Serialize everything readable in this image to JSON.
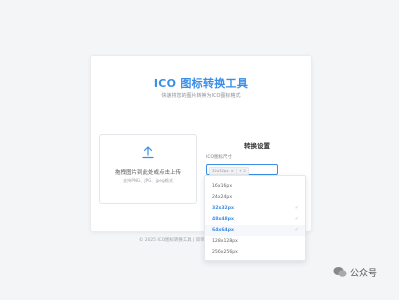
{
  "app": {
    "title": "ICO 图标转换工具",
    "subtitle": "快速将您的图片转换为ICO图标格式"
  },
  "upload": {
    "main_text": "拖拽图片到此处或点击上传",
    "hint_text": "支持PNG、JPG、jpeg格式",
    "icon": "upload-icon"
  },
  "settings": {
    "title": "转换设置",
    "size_label": "ICO图标尺寸",
    "selected_tags": [
      {
        "label": "32x32px"
      },
      {
        "label": "+ 2"
      }
    ],
    "options": [
      {
        "label": "16x16px",
        "selected": false
      },
      {
        "label": "24x24px",
        "selected": false
      },
      {
        "label": "32x32px",
        "selected": true
      },
      {
        "label": "48x48px",
        "selected": true
      },
      {
        "label": "64x64px",
        "selected": true
      },
      {
        "label": "128x128px",
        "selected": false
      },
      {
        "label": "256x256px",
        "selected": false
      }
    ]
  },
  "footer": {
    "text": "© 2025 ICO图标转换工具 | 简单"
  },
  "watermark": {
    "text": "公众号"
  },
  "colors": {
    "accent": "#3a8ee6",
    "background": "#f4f5f7"
  }
}
